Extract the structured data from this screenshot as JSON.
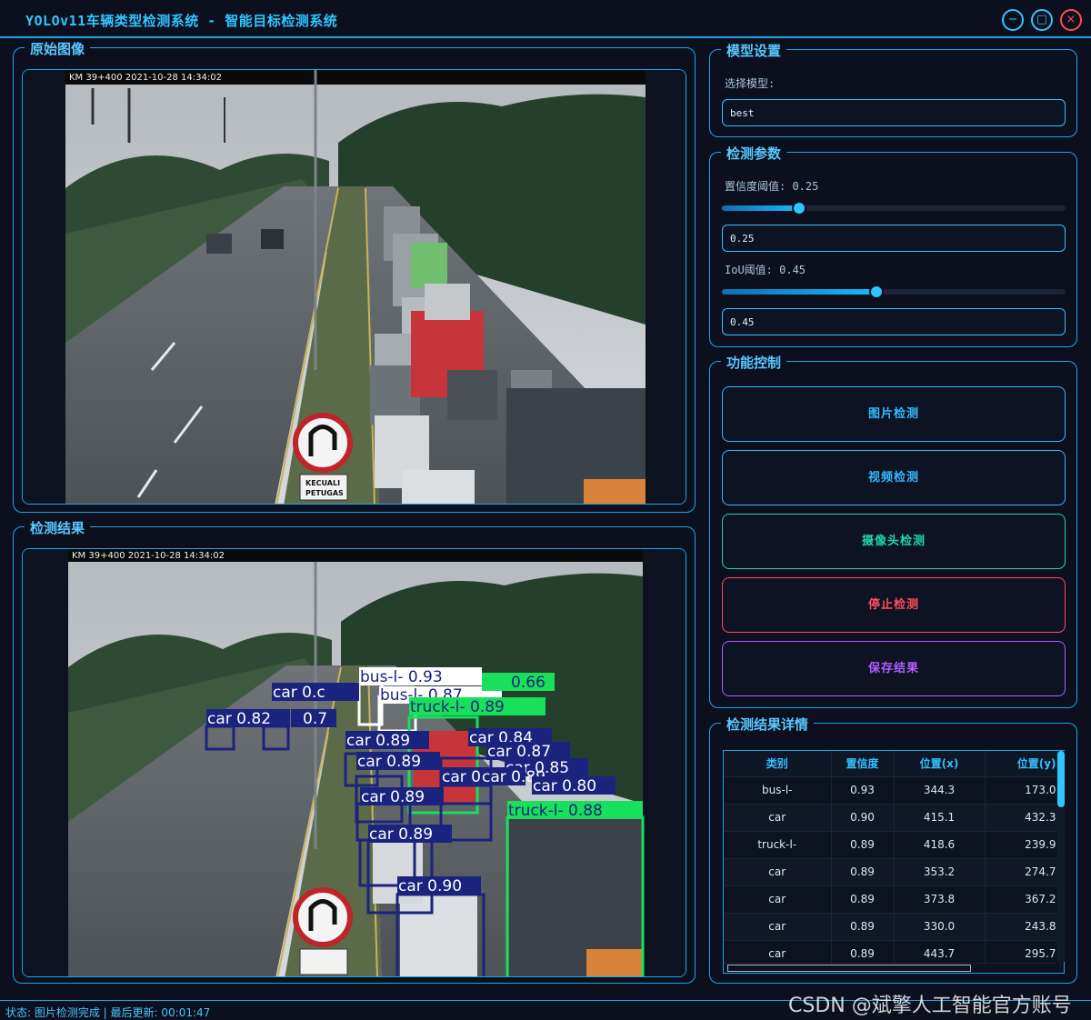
{
  "window": {
    "title": "YOLOv11车辆类型检测系统 - 智能目标检测系统",
    "icons": [
      "minimize-icon",
      "maximize-icon",
      "close-icon"
    ]
  },
  "original_panel": {
    "title": "原始图像",
    "overlay": "KM 39+400 2021-10-28 14:34:02",
    "sign_text": [
      "KECUALI",
      "PETUGAS"
    ]
  },
  "result_panel": {
    "title": "检测结果",
    "overlay": "KM 39+400 2021-10-28 14:34:02",
    "detections": [
      {
        "label": "bus-l- 0.93",
        "color": "#ffffff"
      },
      {
        "label": "bus-l- 0.87",
        "color": "#ffffff"
      },
      {
        "label": "0.66",
        "color": "#18e05a"
      },
      {
        "label": "truck-l- 0.89",
        "color": "#18e05a"
      },
      {
        "label": "car 0.82",
        "color": "#1a237e"
      },
      {
        "label": "0.7",
        "color": "#1a237e"
      },
      {
        "label": "car 0.c",
        "color": "#1a237e"
      },
      {
        "label": "car 0.89",
        "color": "#1a237e"
      },
      {
        "label": "car 0.89",
        "color": "#1a237e"
      },
      {
        "label": "car 0.84",
        "color": "#1a237e"
      },
      {
        "label": "car 0.87",
        "color": "#1a237e"
      },
      {
        "label": "car 0.85",
        "color": "#1a237e"
      },
      {
        "label": "car 0.89",
        "color": "#1a237e"
      },
      {
        "label": "car 0.89",
        "color": "#1a237e"
      },
      {
        "label": "car 0.80",
        "color": "#1a237e"
      },
      {
        "label": "car 0.89",
        "color": "#1a237e"
      },
      {
        "label": "car 0.89",
        "color": "#1a237e"
      },
      {
        "label": "truck-l- 0.88",
        "color": "#18e05a"
      },
      {
        "label": "car 0.90",
        "color": "#1a237e"
      }
    ]
  },
  "model": {
    "title": "模型设置",
    "select_label": "选择模型:",
    "selected": "best"
  },
  "params": {
    "title": "检测参数",
    "conf_label": "置信度阈值: 0.25",
    "conf_value": "0.25",
    "conf_level": 0.25,
    "iou_label": "IoU阈值: 0.45",
    "iou_value": "0.45",
    "iou_level": 0.45
  },
  "controls": {
    "title": "功能控制",
    "image_btn": "图片检测",
    "video_btn": "视频检测",
    "camera_btn": "摄像头检测",
    "stop_btn": "停止检测",
    "save_btn": "保存结果",
    "colors": {
      "image": "#35b8ff",
      "video": "#35b8ff",
      "camera": "#22d3b0",
      "stop": "#ff4d5e",
      "save": "#b25cff"
    }
  },
  "details": {
    "title": "检测结果详情",
    "columns": [
      "类别",
      "置信度",
      "位置(x)",
      "位置(y)"
    ],
    "rows": [
      [
        "bus-l-",
        "0.93",
        "344.3",
        "173.0"
      ],
      [
        "car",
        "0.90",
        "415.1",
        "432.3"
      ],
      [
        "truck-l-",
        "0.89",
        "418.6",
        "239.9"
      ],
      [
        "car",
        "0.89",
        "353.2",
        "274.7"
      ],
      [
        "car",
        "0.89",
        "373.8",
        "367.2"
      ],
      [
        "car",
        "0.89",
        "330.0",
        "243.8"
      ],
      [
        "car",
        "0.89",
        "443.7",
        "295.7"
      ]
    ]
  },
  "status": {
    "text": "状态: 图片检测完成 | 最后更新: 00:01:47"
  },
  "watermark": "CSDN @斌擎人工智能官方账号"
}
